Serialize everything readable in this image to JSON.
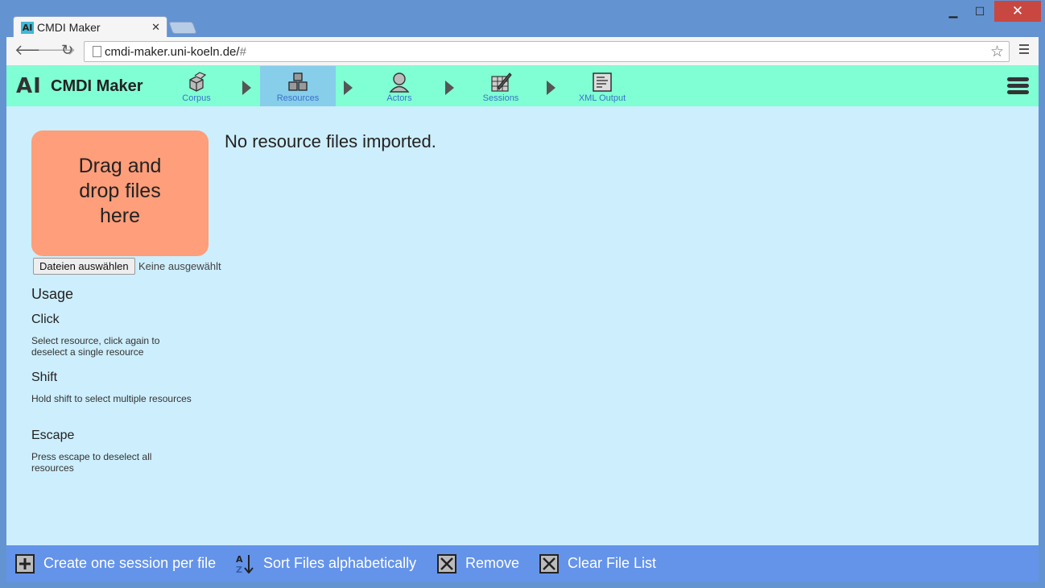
{
  "browser": {
    "tab_title": "CMDI Maker",
    "favicon_text": "AI",
    "url_main": "cmdi-maker.uni-koeln.de/",
    "url_hash": "#"
  },
  "app": {
    "logo_mark": "AI",
    "title": "CMDI Maker",
    "steps": [
      {
        "label": "Corpus",
        "icon": "cubes-icon",
        "active": false
      },
      {
        "label": "Resources",
        "icon": "stacked-cubes-icon",
        "active": true
      },
      {
        "label": "Actors",
        "icon": "person-icon",
        "active": false
      },
      {
        "label": "Sessions",
        "icon": "pen-grid-icon",
        "active": false
      },
      {
        "label": "XML Output",
        "icon": "document-icon",
        "active": false
      }
    ]
  },
  "main": {
    "dropzone_lines": [
      "Drag and",
      "drop files",
      "here"
    ],
    "file_button": "Dateien auswählen",
    "file_status": "Keine ausgewählt",
    "empty_message": "No resource files imported.",
    "usage": {
      "heading": "Usage",
      "items": [
        {
          "key": "Click",
          "desc": "Select resource, click again to deselect a single resource"
        },
        {
          "key": "Shift",
          "desc": "Hold shift to select multiple resources"
        },
        {
          "key": "Escape",
          "desc": "Press escape to deselect all resources"
        }
      ]
    }
  },
  "footer": {
    "buttons": [
      {
        "label": "Create one session per file",
        "icon": "plus-box-icon"
      },
      {
        "label": "Sort Files alphabetically",
        "icon": "sort-az-icon"
      },
      {
        "label": "Remove",
        "icon": "x-box-icon"
      },
      {
        "label": "Clear File List",
        "icon": "x-box-icon"
      }
    ]
  },
  "colors": {
    "appbar": "#80ffd4",
    "active_step": "#87ceeb",
    "content": "#cdeefc",
    "dropzone": "#ff9e7a",
    "footer": "#6493ea"
  }
}
